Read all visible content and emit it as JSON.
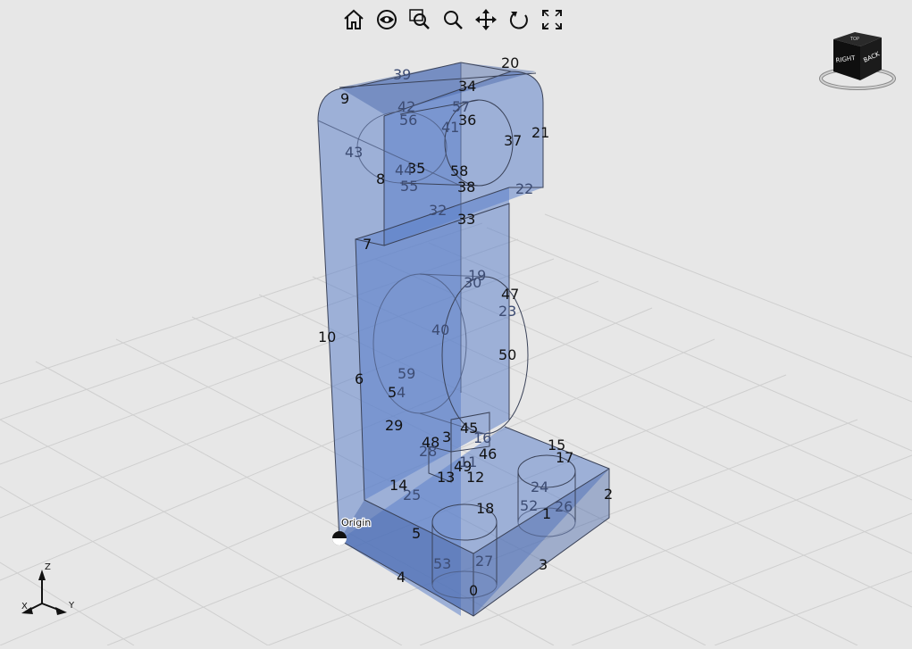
{
  "toolbar": {
    "buttons": [
      {
        "name": "home-view-button",
        "icon": "home-icon"
      },
      {
        "name": "look-at-button",
        "icon": "eye-icon"
      },
      {
        "name": "zoom-window-button",
        "icon": "zoom-window-icon"
      },
      {
        "name": "zoom-button",
        "icon": "magnifier-icon"
      },
      {
        "name": "pan-button",
        "icon": "move-arrows-icon"
      },
      {
        "name": "rotate-button",
        "icon": "rotate-icon"
      },
      {
        "name": "fit-view-button",
        "icon": "fullscreen-icon"
      }
    ]
  },
  "view_cube": {
    "right_label": "RIGHT",
    "back_label": "BACK",
    "top_label": "TOP"
  },
  "origin_label": "Origin",
  "axes": {
    "z": "Z",
    "x": "X",
    "y": "Y"
  },
  "vertex_labels": [
    {
      "text": "39",
      "hidden": true
    },
    {
      "text": "20",
      "hidden": false
    },
    {
      "text": "9",
      "hidden": false
    },
    {
      "text": "34",
      "hidden": false
    },
    {
      "text": "42",
      "hidden": true
    },
    {
      "text": "57",
      "hidden": true
    },
    {
      "text": "56",
      "hidden": true
    },
    {
      "text": "36",
      "hidden": false
    },
    {
      "text": "41",
      "hidden": true
    },
    {
      "text": "21",
      "hidden": false
    },
    {
      "text": "37",
      "hidden": false
    },
    {
      "text": "43",
      "hidden": true
    },
    {
      "text": "35",
      "hidden": false
    },
    {
      "text": "44",
      "hidden": true
    },
    {
      "text": "58",
      "hidden": false
    },
    {
      "text": "8",
      "hidden": false
    },
    {
      "text": "55",
      "hidden": true
    },
    {
      "text": "38",
      "hidden": false
    },
    {
      "text": "22",
      "hidden": true
    },
    {
      "text": "32",
      "hidden": true
    },
    {
      "text": "33",
      "hidden": false
    },
    {
      "text": "7",
      "hidden": false
    },
    {
      "text": "19",
      "hidden": true
    },
    {
      "text": "30",
      "hidden": true
    },
    {
      "text": "47",
      "hidden": false
    },
    {
      "text": "23",
      "hidden": true
    },
    {
      "text": "10",
      "hidden": false
    },
    {
      "text": "40",
      "hidden": true
    },
    {
      "text": "50",
      "hidden": false
    },
    {
      "text": "59",
      "hidden": true
    },
    {
      "text": "6",
      "hidden": false
    },
    {
      "text": "5",
      "hidden": false
    },
    {
      "text": "4",
      "hidden": true
    },
    {
      "text": "29",
      "hidden": false
    },
    {
      "text": "3",
      "hidden": false
    },
    {
      "text": "45",
      "hidden": false
    },
    {
      "text": "48",
      "hidden": false
    },
    {
      "text": "16",
      "hidden": true
    },
    {
      "text": "28",
      "hidden": true
    },
    {
      "text": "46",
      "hidden": false
    },
    {
      "text": "15",
      "hidden": false
    },
    {
      "text": "17",
      "hidden": false
    },
    {
      "text": "49",
      "hidden": false
    },
    {
      "text": "11",
      "hidden": true
    },
    {
      "text": "13",
      "hidden": false
    },
    {
      "text": "12",
      "hidden": false
    },
    {
      "text": "14",
      "hidden": false
    },
    {
      "text": "25",
      "hidden": true
    },
    {
      "text": "2",
      "hidden": false
    },
    {
      "text": "24",
      "hidden": true
    },
    {
      "text": "18",
      "hidden": false
    },
    {
      "text": "52",
      "hidden": true
    },
    {
      "text": "1",
      "hidden": false
    },
    {
      "text": "26",
      "hidden": true
    },
    {
      "text": "5",
      "hidden": false
    },
    {
      "text": "53",
      "hidden": true
    },
    {
      "text": "27",
      "hidden": true
    },
    {
      "text": "3",
      "hidden": false
    },
    {
      "text": "4",
      "hidden": false
    },
    {
      "text": "0",
      "hidden": false
    }
  ],
  "colors": {
    "background": "#e7e7e7",
    "part": "#5b7fc9",
    "grid": "#c9c9c9",
    "edge": "#3a4258"
  }
}
